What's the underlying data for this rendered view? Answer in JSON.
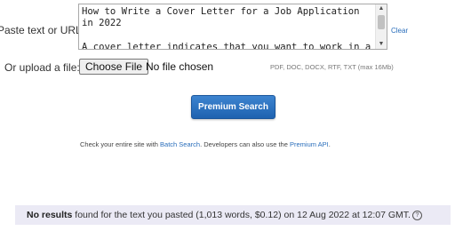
{
  "form": {
    "paste_label": "Paste text or URL:",
    "textarea_text": "How to Write a Cover Letter for a Job Application in 2022\n\nA cover letter indicates that you want to work in a",
    "clear_label": "Clear",
    "upload_label": "Or upload a file:",
    "choose_file_label": "Choose File",
    "file_status": "No file chosen",
    "file_formats": "PDF, DOC, DOCX, RTF, TXT (max 16Mb)"
  },
  "search_button": {
    "label": "Premium Search"
  },
  "info": {
    "prefix": "Check your entire site with ",
    "batch_link": "Batch Search",
    "middle": ". Developers can also use the ",
    "api_link": "Premium API",
    "suffix": "."
  },
  "result": {
    "bold": "No results",
    "text": " found for the text you pasted (1,013 words, $0.12) on 12 Aug 2022 at 12:07 GMT.",
    "help_icon": "question-circle-icon",
    "help_glyph": "?"
  },
  "colors": {
    "link": "#2a6ebb",
    "button": "#2a70c2",
    "result_bg": "#ebeaf5"
  }
}
